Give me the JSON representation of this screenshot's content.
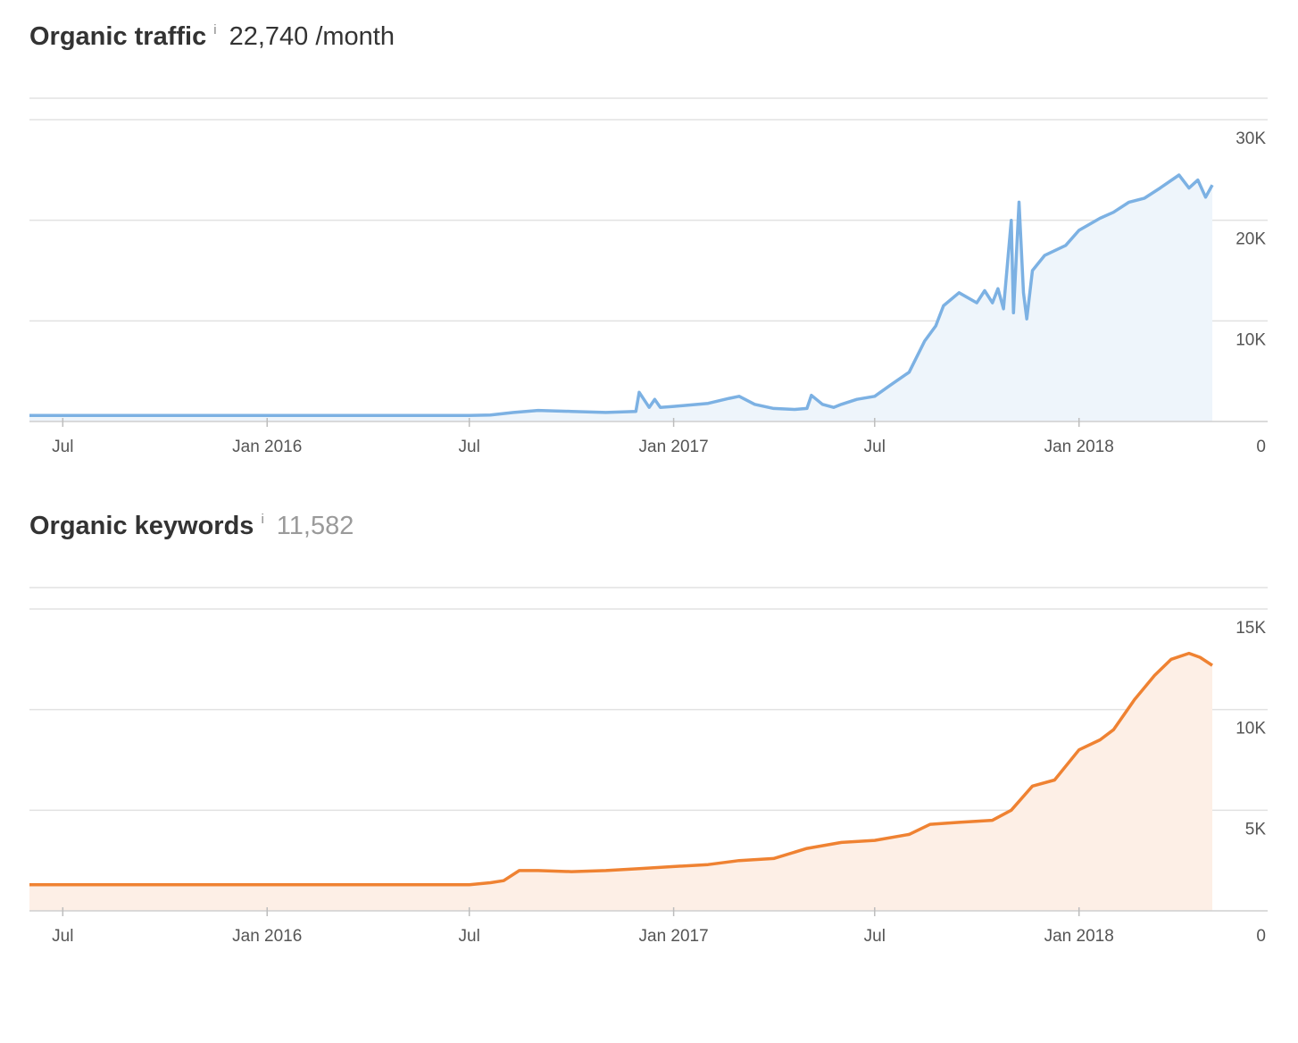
{
  "traffic": {
    "title": "Organic traffic",
    "info": "i",
    "value": "22,740 /month",
    "color": "#7cb1e3",
    "fill": "#eef5fb"
  },
  "keywords": {
    "title": "Organic keywords",
    "info": "i",
    "value": "11,582",
    "color": "#ef8232",
    "fill": "#fdefe6"
  },
  "x_ticks": [
    "Jul",
    "Jan 2016",
    "Jul",
    "Jan 2017",
    "Jul",
    "Jan 2018"
  ],
  "chart_data": [
    {
      "type": "area",
      "title": "Organic traffic",
      "xlabel": "",
      "ylabel": "",
      "x_range": [
        "2015-06-01",
        "2018-05-01"
      ],
      "ylim": [
        0,
        30000
      ],
      "y_ticks": [
        "30K",
        "20K",
        "10K",
        "0"
      ],
      "x_ticks": [
        "Jul",
        "Jan 2016",
        "Jul",
        "Jan 2017",
        "Jul",
        "Jan 2018"
      ],
      "grid": true,
      "series": [
        {
          "x": [
            "2015-06-01",
            "2015-07-01",
            "2016-01-01",
            "2016-07-01",
            "2016-07-20",
            "2016-08-10",
            "2016-09-01",
            "2016-10-01",
            "2016-11-01",
            "2016-11-28",
            "2016-12-01",
            "2016-12-10",
            "2016-12-15",
            "2016-12-20",
            "2017-01-01",
            "2017-02-01",
            "2017-02-20",
            "2017-03-01",
            "2017-03-15",
            "2017-04-01",
            "2017-04-20",
            "2017-05-01",
            "2017-05-05",
            "2017-05-15",
            "2017-05-25",
            "2017-06-01",
            "2017-06-15",
            "2017-07-01",
            "2017-07-15",
            "2017-08-01",
            "2017-08-15",
            "2017-08-25",
            "2017-09-01",
            "2017-09-15",
            "2017-10-01",
            "2017-10-08",
            "2017-10-15",
            "2017-10-20",
            "2017-10-25",
            "2017-11-01",
            "2017-11-03",
            "2017-11-08",
            "2017-11-12",
            "2017-11-15",
            "2017-11-20",
            "2017-12-01",
            "2017-12-20",
            "2018-01-01",
            "2018-01-20",
            "2018-02-01",
            "2018-02-15",
            "2018-03-01",
            "2018-03-15",
            "2018-04-01",
            "2018-04-10",
            "2018-04-18",
            "2018-04-25",
            "2018-05-01"
          ],
          "y": [
            600,
            600,
            600,
            600,
            650,
            900,
            1100,
            1000,
            900,
            1000,
            2900,
            1400,
            2200,
            1400,
            1500,
            1800,
            2300,
            2500,
            1700,
            1300,
            1200,
            1300,
            2600,
            1700,
            1400,
            1700,
            2200,
            2500,
            3600,
            4900,
            8000,
            9500,
            11500,
            12800,
            11800,
            13000,
            11800,
            13200,
            11200,
            20000,
            10800,
            21800,
            12800,
            10200,
            15000,
            16500,
            17500,
            19000,
            20200,
            20800,
            21800,
            22200,
            23200,
            24500,
            23200,
            24000,
            22300,
            23500
          ]
        }
      ]
    },
    {
      "type": "area",
      "title": "Organic keywords",
      "xlabel": "",
      "ylabel": "",
      "x_range": [
        "2015-06-01",
        "2018-05-01"
      ],
      "ylim": [
        0,
        15000
      ],
      "y_ticks": [
        "15K",
        "10K",
        "5K",
        "0"
      ],
      "x_ticks": [
        "Jul",
        "Jan 2016",
        "Jul",
        "Jan 2017",
        "Jul",
        "Jan 2018"
      ],
      "grid": true,
      "series": [
        {
          "x": [
            "2015-06-01",
            "2016-07-01",
            "2016-07-20",
            "2016-08-01",
            "2016-08-15",
            "2016-09-01",
            "2016-10-01",
            "2016-11-01",
            "2016-12-01",
            "2017-01-01",
            "2017-02-01",
            "2017-03-01",
            "2017-04-01",
            "2017-05-01",
            "2017-06-01",
            "2017-07-01",
            "2017-08-01",
            "2017-08-20",
            "2017-09-15",
            "2017-10-15",
            "2017-11-01",
            "2017-11-20",
            "2017-12-10",
            "2018-01-01",
            "2018-01-20",
            "2018-02-01",
            "2018-02-20",
            "2018-03-10",
            "2018-03-25",
            "2018-04-10",
            "2018-04-20",
            "2018-05-01"
          ],
          "y": [
            1300,
            1300,
            1400,
            1500,
            2000,
            2000,
            1950,
            2000,
            2100,
            2200,
            2300,
            2500,
            2600,
            3100,
            3400,
            3500,
            3800,
            4300,
            4400,
            4500,
            5000,
            6200,
            6500,
            8000,
            8500,
            9000,
            10500,
            11700,
            12500,
            12800,
            12600,
            12200
          ]
        }
      ]
    }
  ]
}
